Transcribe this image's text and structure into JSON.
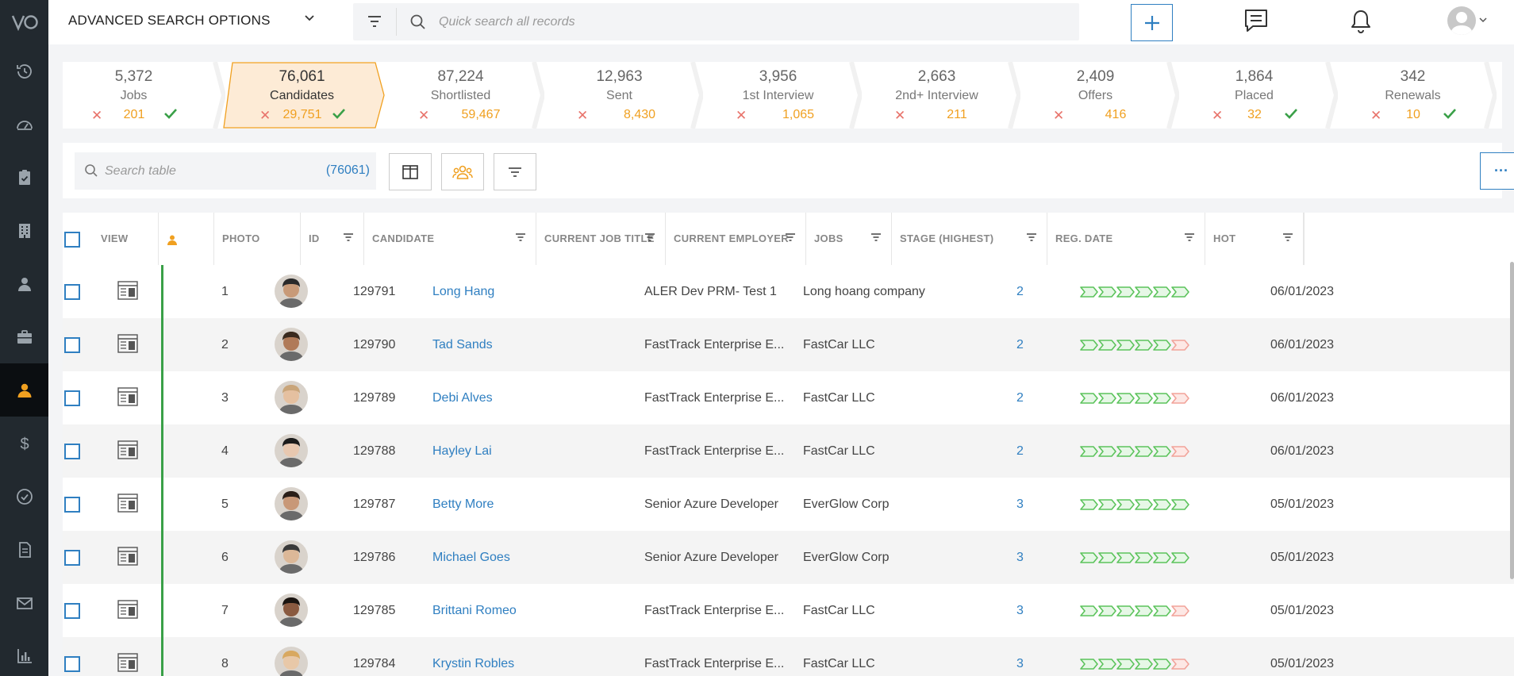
{
  "topbar": {
    "advanced_search_label": "ADVANCED SEARCH OPTIONS",
    "quick_search_placeholder": "Quick search all records"
  },
  "pipeline": [
    {
      "count": "5,372",
      "label": "Jobs",
      "rejected": "201",
      "check": true
    },
    {
      "count": "76,061",
      "label": "Candidates",
      "rejected": "29,751",
      "check": true,
      "active": true
    },
    {
      "count": "87,224",
      "label": "Shortlisted",
      "rejected": "59,467",
      "check": false
    },
    {
      "count": "12,963",
      "label": "Sent",
      "rejected": "8,430",
      "check": false
    },
    {
      "count": "3,956",
      "label": "1st Interview",
      "rejected": "1,065",
      "check": false
    },
    {
      "count": "2,663",
      "label": "2nd+ Interview",
      "rejected": "211",
      "check": false
    },
    {
      "count": "2,409",
      "label": "Offers",
      "rejected": "416",
      "check": false
    },
    {
      "count": "1,864",
      "label": "Placed",
      "rejected": "32",
      "check": true
    },
    {
      "count": "342",
      "label": "Renewals",
      "rejected": "10",
      "check": true
    }
  ],
  "table_toolbar": {
    "search_placeholder": "Search table",
    "record_count": "(76061)",
    "more_label": "···"
  },
  "columns": [
    "VIEW",
    "PHOTO",
    "ID",
    "CANDIDATE",
    "CURRENT JOB TITLE",
    "CURRENT EMPLOYER",
    "JOBS",
    "STAGE (HIGHEST)",
    "REG. DATE",
    "HOT"
  ],
  "rows": [
    {
      "num": "1",
      "id": "129791",
      "name": "Long Hang",
      "title": "ALER Dev PRM- Test 1",
      "employer": "Long hoang company",
      "jobs": "2",
      "stages_complete": 6,
      "date": "06/01/2023",
      "skin": "#c89a78",
      "hair": "#2a2a2a"
    },
    {
      "num": "2",
      "id": "129790",
      "name": "Tad Sands",
      "title": "FastTrack Enterprise E...",
      "employer": "FastCar LLC",
      "jobs": "2",
      "stages_complete": 5,
      "date": "06/01/2023",
      "skin": "#b07a58",
      "hair": "#3a2a1e"
    },
    {
      "num": "3",
      "id": "129789",
      "name": "Debi Alves",
      "title": "FastTrack Enterprise E...",
      "employer": "FastCar LLC",
      "jobs": "2",
      "stages_complete": 5,
      "date": "06/01/2023",
      "skin": "#e5c0a0",
      "hair": "#c9a57a"
    },
    {
      "num": "4",
      "id": "129788",
      "name": "Hayley Lai",
      "title": "FastTrack Enterprise E...",
      "employer": "FastCar LLC",
      "jobs": "2",
      "stages_complete": 5,
      "date": "06/01/2023",
      "skin": "#e8c8b0",
      "hair": "#1c1c1c"
    },
    {
      "num": "5",
      "id": "129787",
      "name": "Betty More",
      "title": "Senior Azure Developer",
      "employer": "EverGlow Corp",
      "jobs": "3",
      "stages_complete": 6,
      "date": "05/01/2023",
      "skin": "#c89878",
      "hair": "#2a1e18"
    },
    {
      "num": "6",
      "id": "129786",
      "name": "Michael Goes",
      "title": "Senior Azure Developer",
      "employer": "EverGlow Corp",
      "jobs": "3",
      "stages_complete": 6,
      "date": "05/01/2023",
      "skin": "#dcb898",
      "hair": "#3a3a3a"
    },
    {
      "num": "7",
      "id": "129785",
      "name": "Brittani Romeo",
      "title": "FastTrack Enterprise E...",
      "employer": "FastCar LLC",
      "jobs": "3",
      "stages_complete": 5,
      "date": "05/01/2023",
      "skin": "#8a5a40",
      "hair": "#1a1410"
    },
    {
      "num": "8",
      "id": "129784",
      "name": "Krystin Robles",
      "title": "FastTrack Enterprise E...",
      "employer": "FastCar LLC",
      "jobs": "3",
      "stages_complete": 5,
      "date": "05/01/2023",
      "skin": "#e8c8a8",
      "hair": "#d8a860"
    }
  ],
  "colors": {
    "accent": "#2f7fc1",
    "active_stage_fill": "#fdebd6",
    "active_stage_border": "#f0a020",
    "reject": "#e8736b",
    "reject_count": "#f0a020",
    "check": "#3aa048",
    "stage_done": "#5cc35c",
    "stage_pending": "#f2a39a",
    "nav_bg": "#22292f",
    "nav_active_icon": "#f0a020"
  }
}
